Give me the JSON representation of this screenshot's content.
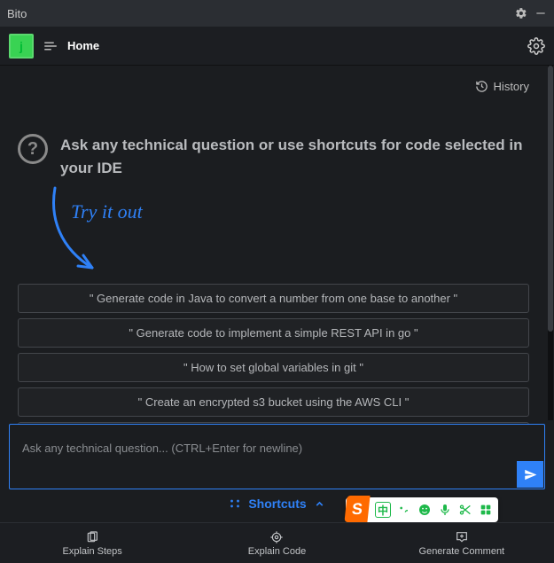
{
  "titlebar": {
    "title": "Bito"
  },
  "topbar": {
    "avatar_initial": "j",
    "home_label": "Home"
  },
  "history_label": "History",
  "hero": {
    "prompt": "Ask any technical question or use shortcuts for code selected in your IDE",
    "try_it": "Try it out"
  },
  "suggestions": [
    "\" Generate code in Java to convert a number from one base to another \"",
    "\" Generate code to implement a simple REST API in go \"",
    "\" How to set global variables in git \"",
    "\" Create an encrypted s3 bucket using the AWS CLI \""
  ],
  "input": {
    "placeholder": "Ask any technical question... (CTRL+Enter for newline)"
  },
  "shortcuts_label": "Shortcuts",
  "ime": {
    "logo": "S",
    "lang": "中"
  },
  "tabs": {
    "explain_steps": "Explain Steps",
    "explain_code": "Explain Code",
    "generate_comment": "Generate Comment"
  }
}
